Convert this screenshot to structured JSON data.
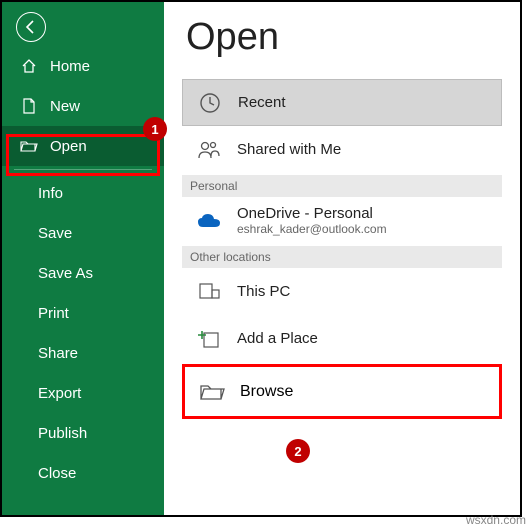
{
  "title": "Open",
  "sidebar": {
    "home": "Home",
    "new": "New",
    "open": "Open",
    "info": "Info",
    "save": "Save",
    "saveas": "Save As",
    "print": "Print",
    "share": "Share",
    "export": "Export",
    "publish": "Publish",
    "close": "Close"
  },
  "locations": {
    "recent": "Recent",
    "shared": "Shared with Me",
    "personal_header": "Personal",
    "onedrive": "OneDrive - Personal",
    "onedrive_email": "eshrak_kader@outlook.com",
    "other_header": "Other locations",
    "thispc": "This PC",
    "addplace": "Add a Place",
    "browse": "Browse"
  },
  "badges": {
    "b1": "1",
    "b2": "2"
  },
  "watermark": "wsxdn.com"
}
